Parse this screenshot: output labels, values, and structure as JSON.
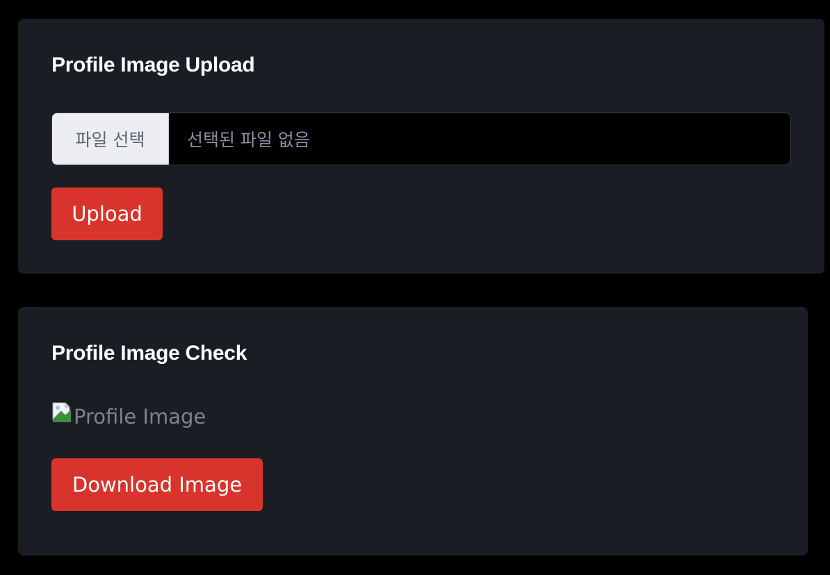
{
  "upload_card": {
    "title": "Profile Image Upload",
    "file_input": {
      "button_label": "파일 선택",
      "status_text": "선택된 파일 없음"
    },
    "upload_button": "Upload"
  },
  "check_card": {
    "title": "Profile Image Check",
    "image_alt": "Profile Image",
    "image_icon": "broken-image-icon",
    "download_button": "Download Image"
  },
  "colors": {
    "background": "#000000",
    "card": "#1b1d24",
    "accent": "#d9342b",
    "muted_text": "#8c8fa6"
  }
}
